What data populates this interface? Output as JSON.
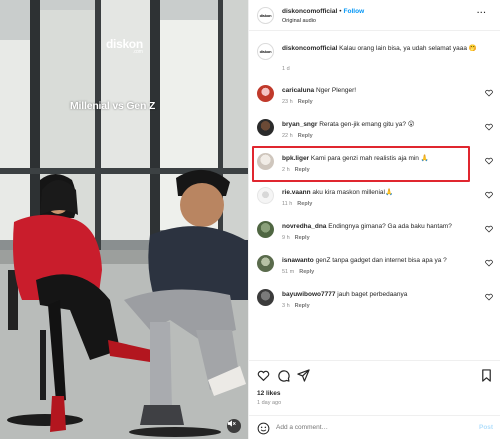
{
  "media": {
    "watermark": "diskon",
    "watermark_sub": ".com",
    "overlay_text": "Millenial vs Gen Z",
    "mute_icon": "speaker-muted-icon"
  },
  "header": {
    "username": "diskoncomofficial",
    "separator": "•",
    "follow_label": "Follow",
    "audio": "Original audio",
    "more_icon": "more-horizontal-icon",
    "avatar_text": "diskon"
  },
  "caption": {
    "username": "diskoncomofficial",
    "text": "Kalau orang lain bisa, ya udah selamat yaaa 🤭",
    "time": "1 d"
  },
  "comments": [
    {
      "username": "caricaluna",
      "text": "Nger Plenger!",
      "time": "23 h",
      "reply": "Reply"
    },
    {
      "username": "bryan_sngr",
      "text": "Rerata gen-jik emang gitu ya? 😮",
      "time": "22 h",
      "reply": "Reply"
    },
    {
      "username": "bpk.liger",
      "text": "Kami para genzi mah realistis aja min 🙏",
      "time": "2 h",
      "reply": "Reply"
    },
    {
      "username": "rie.vaann",
      "text": "aku kira maskon millenial🙏",
      "time": "11 h",
      "reply": "Reply"
    },
    {
      "username": "novredha_dna",
      "text": "Endingnya gimana? Ga ada baku hantam?",
      "time": "9 h",
      "reply": "Reply"
    },
    {
      "username": "isnawanto",
      "text": "genZ tanpa gadget dan internet bisa apa ya ?",
      "time": "51 m",
      "reply": "Reply"
    },
    {
      "username": "bayuwibowo7777",
      "text": "jauh baget perbedaanya",
      "time": "3 h",
      "reply": "Reply"
    }
  ],
  "actions": {
    "likes": "12 likes",
    "time_ago": "1 day ago",
    "add_comment_placeholder": "Add a comment…",
    "post_label": "Post",
    "icons": [
      "heart-icon",
      "comment-icon",
      "share-icon",
      "bookmark-icon"
    ]
  },
  "colors": {
    "accent": "#0095f6",
    "highlight": "#e0262f",
    "muted_text": "#8e8e8e",
    "post_disabled": "#b2dffc"
  }
}
